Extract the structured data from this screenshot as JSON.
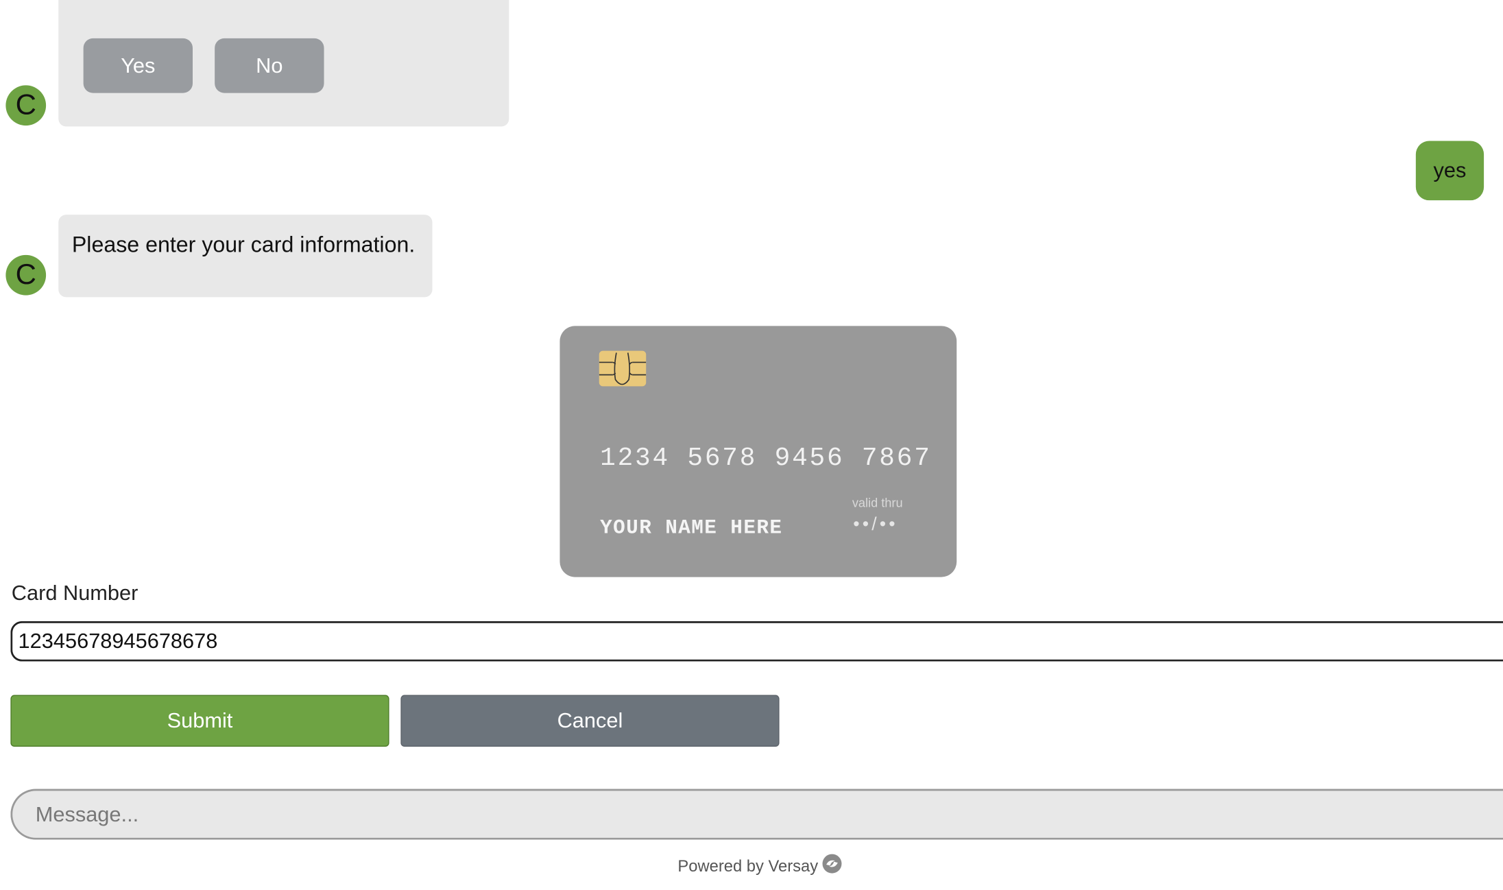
{
  "conversation": {
    "bot_initial": "C",
    "quick_replies": [
      "Yes",
      "No"
    ],
    "user_reply": "yes",
    "bot_prompt": "Please enter your card information."
  },
  "card_preview": {
    "number": "1234 5678 9456 7867",
    "name": "YOUR NAME HERE",
    "valid_thru_label": "valid thru",
    "expiry": "••/••"
  },
  "form": {
    "card_number_label": "Card Number",
    "card_number_value": "12345678945678678",
    "submit_label": "Submit",
    "cancel_label": "Cancel"
  },
  "composer": {
    "placeholder": "Message..."
  },
  "footer": {
    "powered_by": "Powered by Versay"
  },
  "colors": {
    "brand_green": "#6ea343",
    "cancel_gray": "#6c747c",
    "bubble_gray": "#e8e8e8",
    "card_gray": "#999999"
  },
  "icons": {
    "card_chip": "chip-icon",
    "footer_logo": "versay-logo-icon"
  }
}
